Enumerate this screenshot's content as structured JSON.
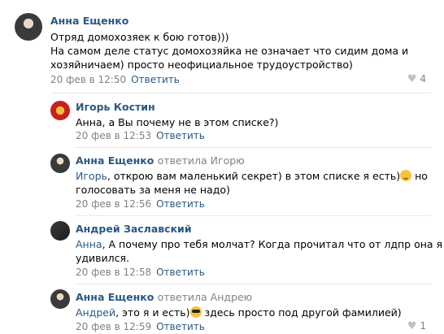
{
  "comments": [
    {
      "author": "Анна Ещенко",
      "lines": [
        "Отряд домохозяек к бою готов)))",
        "На самом деле статус домохозяйка не означает что сидим дома и",
        "хозяйничаем) просто неофициальное трудоустройство)"
      ],
      "date": "20 фев в 12:50",
      "reply": "Ответить",
      "likes": "4"
    },
    {
      "author": "Игорь Костин",
      "text": "Анна, а Вы почему не в этом списке?)",
      "date": "20 фев в 12:53",
      "reply": "Ответить"
    },
    {
      "author": "Анна Ещенко",
      "reply_to": "ответила Игорю",
      "addressee": "Игорь",
      "line1_rest": ", открою вам маленький секрет) в этом списке я есть)",
      "line1_after_emoji": " но",
      "line2": "голосовать за меня не надо)",
      "date": "20 фев в 12:56",
      "reply": "Ответить"
    },
    {
      "author": "Андрей Заславский",
      "addressee": "Анна",
      "line1_rest": ", А почему про тебя молчат? Когда прочитал что от лдпр она я",
      "line2": "удивился.",
      "date": "20 фев в 12:58",
      "reply": "Ответить"
    },
    {
      "author": "Анна Ещенко",
      "reply_to": "ответила Андрею",
      "addressee": "Андрей",
      "line1_rest": ", это я и есть)",
      "line1_after_emoji": " здесь просто под другой фамилией)",
      "date": "20 фев в 12:59",
      "reply": "Ответить",
      "likes": "1"
    }
  ],
  "icons": {
    "like": "heart-icon",
    "wink": "wink-emoji-icon",
    "cool": "sunglasses-emoji-icon"
  }
}
